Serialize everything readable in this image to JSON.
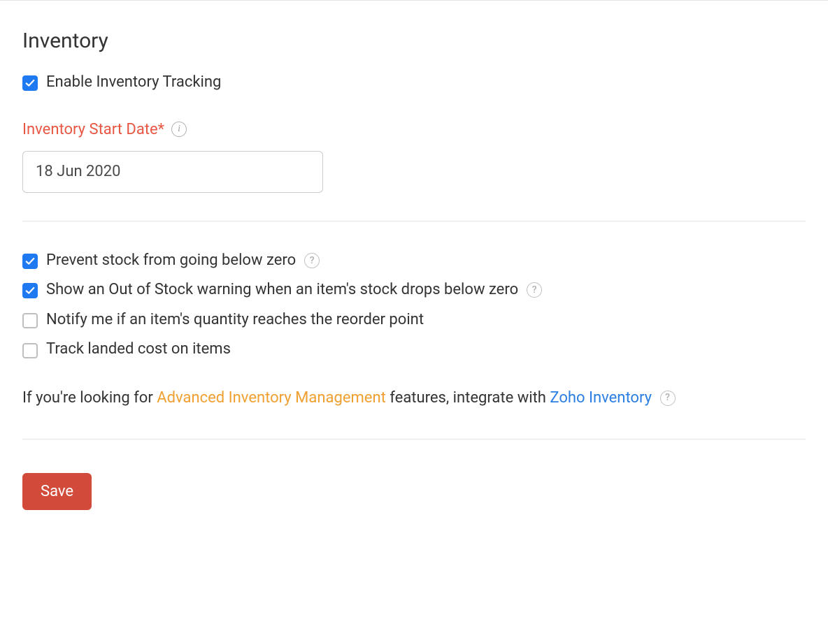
{
  "section": {
    "heading": "Inventory"
  },
  "options": {
    "enable_tracking": {
      "label": "Enable Inventory Tracking",
      "checked": true
    },
    "prevent_below_zero": {
      "label": "Prevent stock from going below zero",
      "checked": true
    },
    "out_of_stock_warning": {
      "label": "Show an Out of Stock warning when an item's stock drops below zero",
      "checked": true
    },
    "notify_reorder": {
      "label": "Notify me if an item's quantity reaches the reorder point",
      "checked": false
    },
    "track_landed_cost": {
      "label": "Track landed cost on items",
      "checked": false
    }
  },
  "start_date": {
    "label": "Inventory Start Date*",
    "value": "18 Jun 2020"
  },
  "advanced_text": {
    "prefix": "If you're looking for ",
    "highlight": "Advanced Inventory Management",
    "middle": " features, integrate with ",
    "link": "Zoho Inventory"
  },
  "buttons": {
    "save": "Save"
  }
}
